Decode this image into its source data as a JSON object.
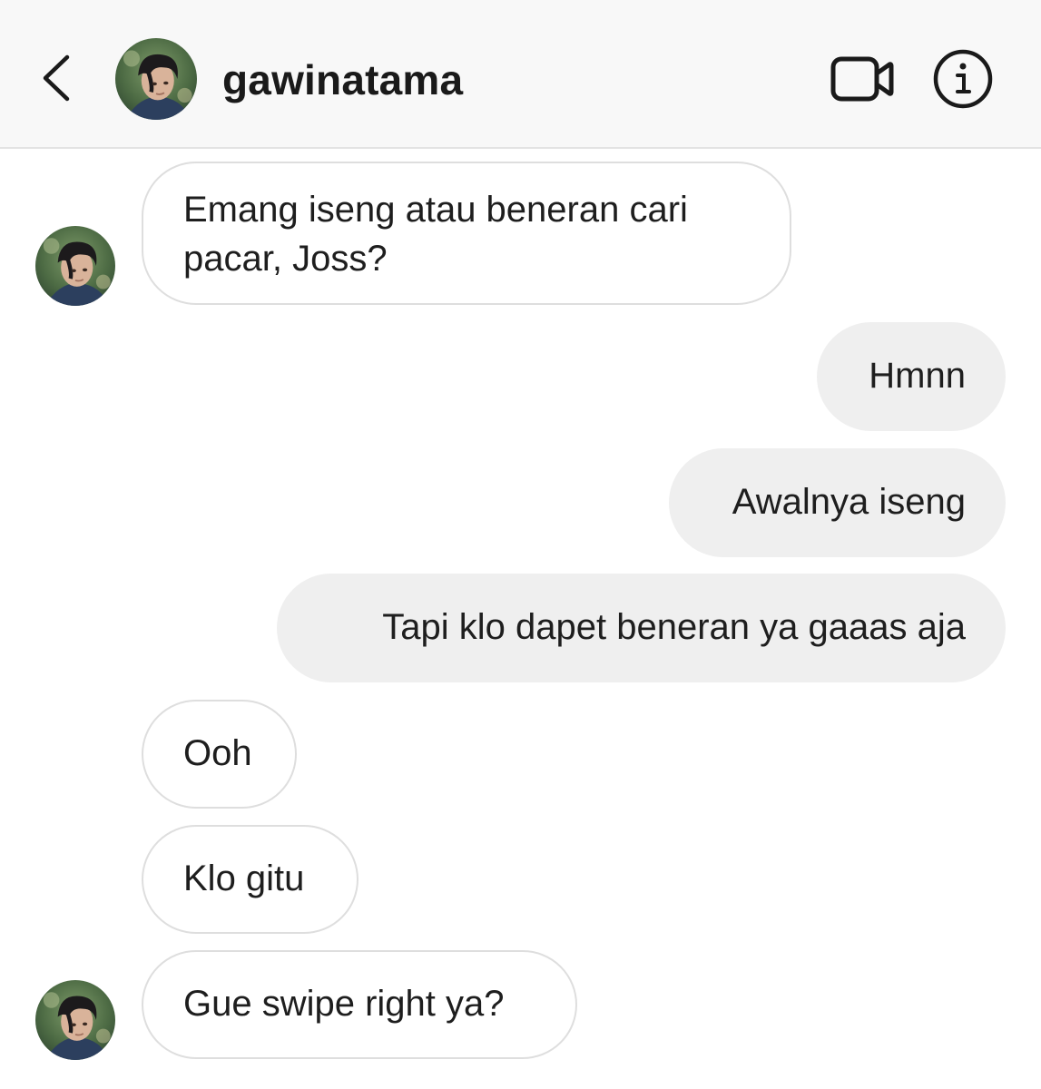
{
  "header": {
    "username": "gawinatama",
    "back_icon": "chevron-left-icon",
    "video_icon": "video-camera-icon",
    "info_icon": "info-icon"
  },
  "messages": [
    {
      "from": "them",
      "text_line1": "Emang iseng atau beneran cari",
      "text_line2": "pacar, Joss?"
    },
    {
      "from": "me",
      "text": "Hmnn"
    },
    {
      "from": "me",
      "text": "Awalnya iseng"
    },
    {
      "from": "me",
      "text": "Tapi klo dapet beneran ya gaaas aja"
    },
    {
      "from": "them",
      "text": "Ooh"
    },
    {
      "from": "them",
      "text": "Klo gitu"
    },
    {
      "from": "them",
      "text": "Gue swipe right ya?"
    }
  ],
  "colors": {
    "header_bg": "#f8f8f8",
    "outgoing_bubble": "#efefef",
    "incoming_border": "#dedede"
  }
}
